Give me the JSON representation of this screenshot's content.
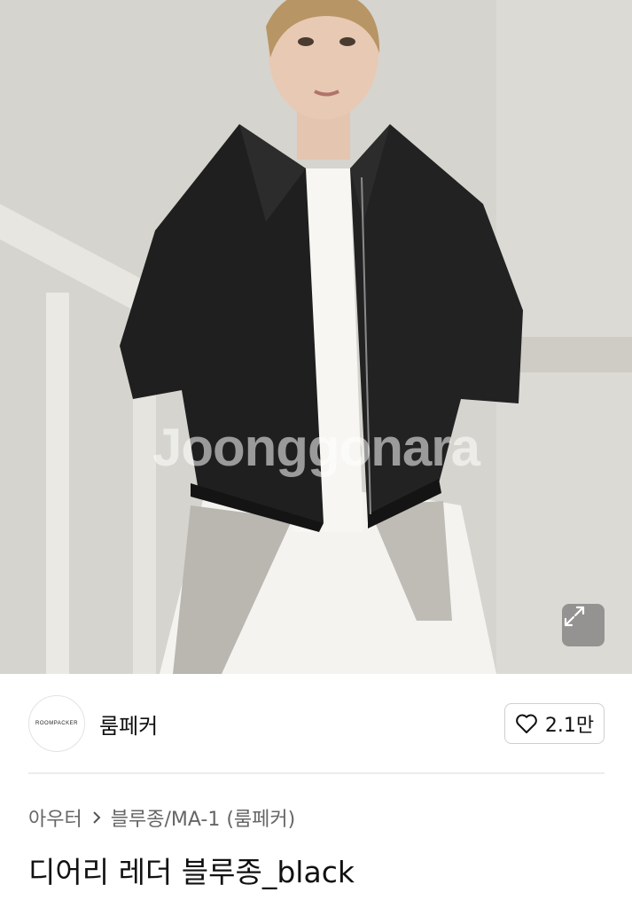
{
  "hero": {
    "watermark": "Joonggonara",
    "expand_icon": "expand-icon"
  },
  "seller": {
    "logo_text": "ROOMPACKER",
    "name": "룸페커"
  },
  "like": {
    "icon": "heart-icon",
    "count": "2.1만"
  },
  "breadcrumb": {
    "category": "아우터",
    "separator_icon": "chevron-right-icon",
    "subcategory": "블루종/MA-1 (룸페커)"
  },
  "product": {
    "title": "디어리 레더 블루종_black"
  }
}
